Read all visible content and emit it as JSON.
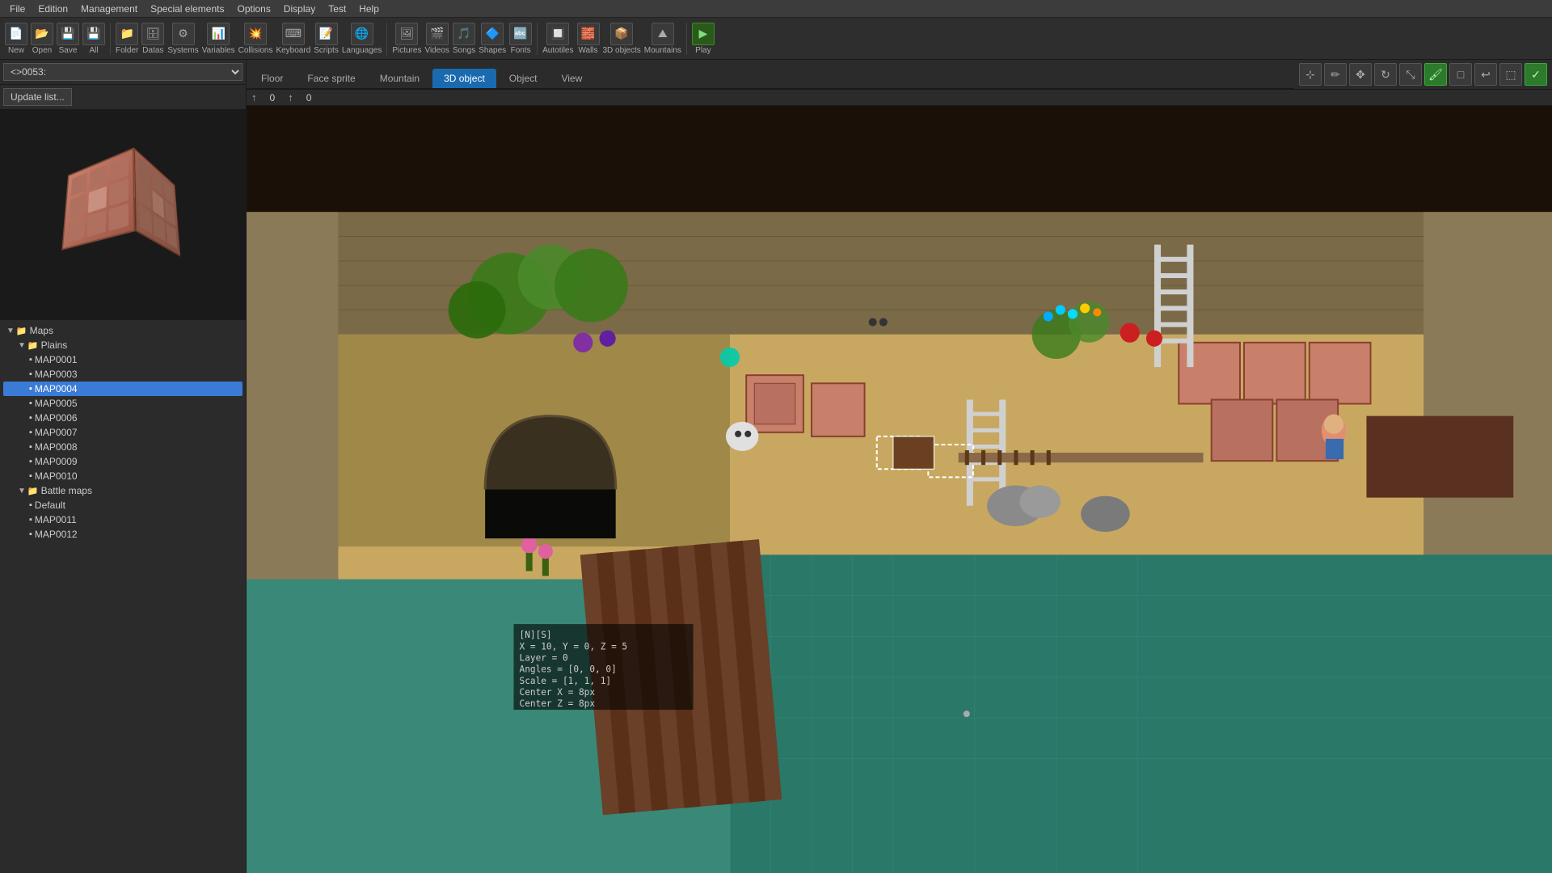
{
  "menubar": {
    "items": [
      "File",
      "Edition",
      "Management",
      "Special elements",
      "Options",
      "Display",
      "Test",
      "Help"
    ]
  },
  "toolbar": {
    "groups": [
      {
        "label": "New",
        "icon": "📄"
      },
      {
        "label": "Open",
        "icon": "📂"
      },
      {
        "label": "Save",
        "icon": "💾"
      },
      {
        "label": "All",
        "icon": "💾"
      },
      {
        "label": "Folder",
        "icon": "📁"
      },
      {
        "label": "Datas",
        "icon": "🗄"
      },
      {
        "label": "Systems",
        "icon": "⚙"
      },
      {
        "label": "Variables",
        "icon": "📊"
      },
      {
        "label": "Collisions",
        "icon": "💥"
      },
      {
        "label": "Keyboard",
        "icon": "⌨"
      },
      {
        "label": "Scripts",
        "icon": "📝"
      },
      {
        "label": "Languages",
        "icon": "🌐"
      },
      {
        "label": "Pictures",
        "icon": "🖼"
      },
      {
        "label": "Videos",
        "icon": "🎬"
      },
      {
        "label": "Songs",
        "icon": "🎵"
      },
      {
        "label": "Shapes",
        "icon": "🔷"
      },
      {
        "label": "Fonts",
        "icon": "🔤"
      },
      {
        "label": "Autotiles",
        "icon": "🔲"
      },
      {
        "label": "Walls",
        "icon": "🧱"
      },
      {
        "label": "3D objects",
        "icon": "📦"
      },
      {
        "label": "Mountains",
        "icon": "⛰"
      },
      {
        "label": "Play",
        "icon": "▶"
      }
    ]
  },
  "left_panel": {
    "map_selector": "<>0053:",
    "update_button": "Update list...",
    "preview_alt": "3D wooden crate preview"
  },
  "tree": {
    "items": [
      {
        "id": "maps",
        "label": "Maps",
        "indent": 0,
        "type": "group",
        "expanded": true
      },
      {
        "id": "plains",
        "label": "Plains",
        "indent": 1,
        "type": "group",
        "expanded": true
      },
      {
        "id": "map0001",
        "label": "MAP0001",
        "indent": 2,
        "type": "map",
        "selected": false
      },
      {
        "id": "map0003",
        "label": "MAP0003",
        "indent": 2,
        "type": "map",
        "selected": false
      },
      {
        "id": "map0004",
        "label": "MAP0004",
        "indent": 2,
        "type": "map",
        "selected": true
      },
      {
        "id": "map0005",
        "label": "MAP0005",
        "indent": 2,
        "type": "map",
        "selected": false
      },
      {
        "id": "map0006",
        "label": "MAP0006",
        "indent": 2,
        "type": "map",
        "selected": false
      },
      {
        "id": "map0007",
        "label": "MAP0007",
        "indent": 2,
        "type": "map",
        "selected": false
      },
      {
        "id": "map0008",
        "label": "MAP0008",
        "indent": 2,
        "type": "map",
        "selected": false
      },
      {
        "id": "map0009",
        "label": "MAP0009",
        "indent": 2,
        "type": "map",
        "selected": false
      },
      {
        "id": "map0010",
        "label": "MAP0010",
        "indent": 2,
        "type": "map",
        "selected": false
      },
      {
        "id": "battlemaps",
        "label": "Battle maps",
        "indent": 1,
        "type": "group",
        "expanded": true
      },
      {
        "id": "default",
        "label": "Default",
        "indent": 2,
        "type": "map",
        "selected": false
      },
      {
        "id": "map0011",
        "label": "MAP0011",
        "indent": 2,
        "type": "map",
        "selected": false
      },
      {
        "id": "map0012",
        "label": "MAP0012",
        "indent": 2,
        "type": "map",
        "selected": false
      }
    ]
  },
  "tabs": {
    "items": [
      "Floor",
      "Face sprite",
      "Mountain",
      "3D object",
      "Object",
      "View"
    ],
    "active": "3D object"
  },
  "coords": {
    "x": "0",
    "y": "0"
  },
  "right_toolbar_buttons": [
    {
      "id": "cursor",
      "icon": "⊹",
      "active": false
    },
    {
      "id": "pencil",
      "icon": "✏",
      "active": false
    },
    {
      "id": "move",
      "icon": "✥",
      "active": false
    },
    {
      "id": "rotate",
      "icon": "↻",
      "active": false
    },
    {
      "id": "scale",
      "icon": "⤡",
      "active": false
    },
    {
      "id": "draw",
      "icon": "🖌",
      "active": true,
      "color": "green"
    },
    {
      "id": "erase",
      "icon": "□",
      "active": false
    },
    {
      "id": "undo",
      "icon": "↩",
      "active": false
    },
    {
      "id": "placeholder",
      "icon": "⬚",
      "active": false
    },
    {
      "id": "confirm",
      "icon": "✓",
      "active": true,
      "color": "green"
    }
  ],
  "map_info": {
    "line1": "[N][S]",
    "line2": "X = 10, Y = 0, Z = 5",
    "line3": "Layer = 0",
    "line4": "Angles = [0, 0, 0]",
    "line5": "Scale = [1, 1, 1]",
    "line6": "Center X = 8px",
    "line7": "Center Z = 8px"
  }
}
